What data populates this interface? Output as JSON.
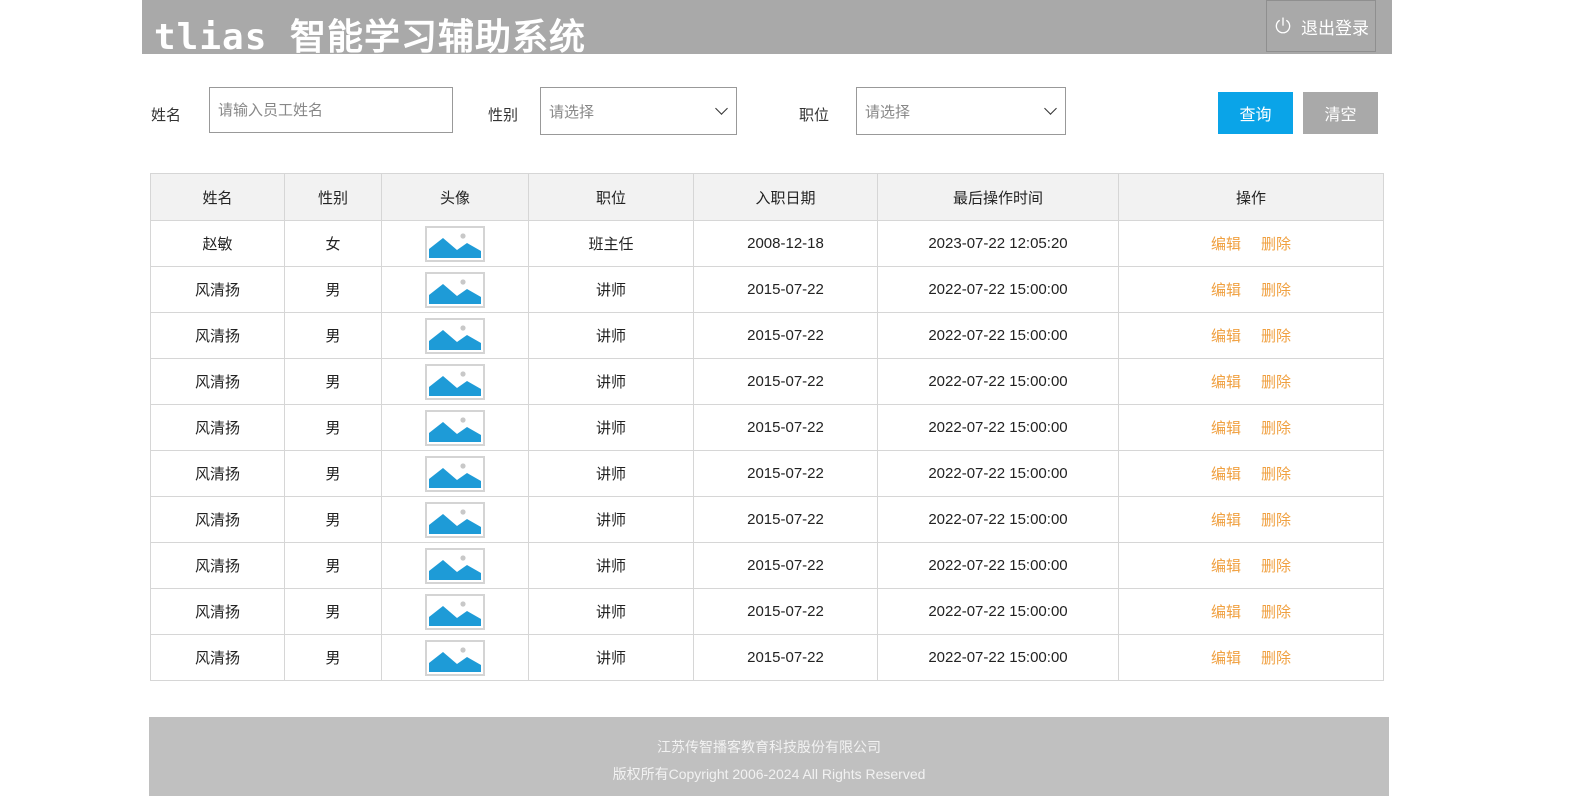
{
  "header": {
    "title": "tlias 智能学习辅助系统",
    "logout_label": "退出登录",
    "logout_icon": "power-icon"
  },
  "search": {
    "name_label": "姓名",
    "name_placeholder": "请输入员工姓名",
    "gender_label": "性别",
    "gender_value": "请选择",
    "job_label": "职位",
    "job_value": "请选择",
    "query_label": "查询",
    "clear_label": "清空"
  },
  "table": {
    "columns": [
      "姓名",
      "性别",
      "头像",
      "职位",
      "入职日期",
      "最后操作时间",
      "操作"
    ],
    "rows": [
      {
        "name": "赵敏",
        "gender": "女",
        "job": "班主任",
        "entry_date": "2008-12-18",
        "update_time": "2023-07-22 12:05:20"
      },
      {
        "name": "风清扬",
        "gender": "男",
        "job": "讲师",
        "entry_date": "2015-07-22",
        "update_time": "2022-07-22 15:00:00"
      },
      {
        "name": "风清扬",
        "gender": "男",
        "job": "讲师",
        "entry_date": "2015-07-22",
        "update_time": "2022-07-22 15:00:00"
      },
      {
        "name": "风清扬",
        "gender": "男",
        "job": "讲师",
        "entry_date": "2015-07-22",
        "update_time": "2022-07-22 15:00:00"
      },
      {
        "name": "风清扬",
        "gender": "男",
        "job": "讲师",
        "entry_date": "2015-07-22",
        "update_time": "2022-07-22 15:00:00"
      },
      {
        "name": "风清扬",
        "gender": "男",
        "job": "讲师",
        "entry_date": "2015-07-22",
        "update_time": "2022-07-22 15:00:00"
      },
      {
        "name": "风清扬",
        "gender": "男",
        "job": "讲师",
        "entry_date": "2015-07-22",
        "update_time": "2022-07-22 15:00:00"
      },
      {
        "name": "风清扬",
        "gender": "男",
        "job": "讲师",
        "entry_date": "2015-07-22",
        "update_time": "2022-07-22 15:00:00"
      },
      {
        "name": "风清扬",
        "gender": "男",
        "job": "讲师",
        "entry_date": "2015-07-22",
        "update_time": "2022-07-22 15:00:00"
      },
      {
        "name": "风清扬",
        "gender": "男",
        "job": "讲师",
        "entry_date": "2015-07-22",
        "update_time": "2022-07-22 15:00:00"
      }
    ],
    "edit_label": "编辑",
    "delete_label": "删除",
    "avatar_icon": "image-placeholder-icon"
  },
  "footer": {
    "company": "江苏传智播客教育科技股份有限公司",
    "copyright": "版权所有Copyright 2006-2024  All Rights Reserved"
  },
  "colors": {
    "header_bg": "#a9a9a9",
    "primary": "#0aa4e8",
    "link": "#f0a040",
    "avatar_blue": "#1e9bd7",
    "footer_bg": "#c0c0c0"
  }
}
